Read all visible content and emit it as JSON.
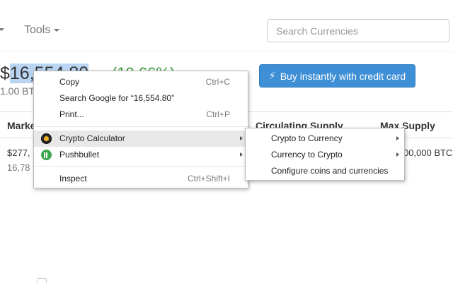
{
  "navbar": {
    "tools_label": "Tools",
    "search_placeholder": "Search Currencies"
  },
  "coin": {
    "price_selected": "16,554.80",
    "price_prefix": "$",
    "change": "(19.66%)",
    "btc_sub": "1.00 BT",
    "buy_button": "Buy instantly with credit card"
  },
  "table": {
    "headers": [
      "Marke",
      "Circulating Supply",
      "Max Supply"
    ],
    "row": {
      "market_cap": "$277,",
      "market_sub": "16,78",
      "max_supply": "00,000 BTC"
    }
  },
  "context_menu": {
    "items": [
      {
        "label": "Copy",
        "shortcut": "Ctrl+C"
      },
      {
        "label": "Search Google for “16,554.80”",
        "shortcut": ""
      },
      {
        "label": "Print...",
        "shortcut": "Ctrl+P"
      },
      {
        "label": "Crypto Calculator",
        "icon": "crypto-calculator-icon"
      },
      {
        "label": "Pushbullet",
        "icon": "pushbullet-icon"
      },
      {
        "label": "Inspect",
        "shortcut": "Ctrl+Shift+I"
      }
    ],
    "highlighted": "Crypto Calculator"
  },
  "submenu": {
    "items": [
      {
        "label": "Crypto to Currency"
      },
      {
        "label": "Currency to Crypto"
      },
      {
        "label": "Configure coins and currencies"
      }
    ]
  },
  "colors": {
    "buy_button": "#3f8fd6",
    "change_positive": "#3c9a3c",
    "selection": "#b9d5f2",
    "menu_highlight": "#e8e8e8"
  }
}
